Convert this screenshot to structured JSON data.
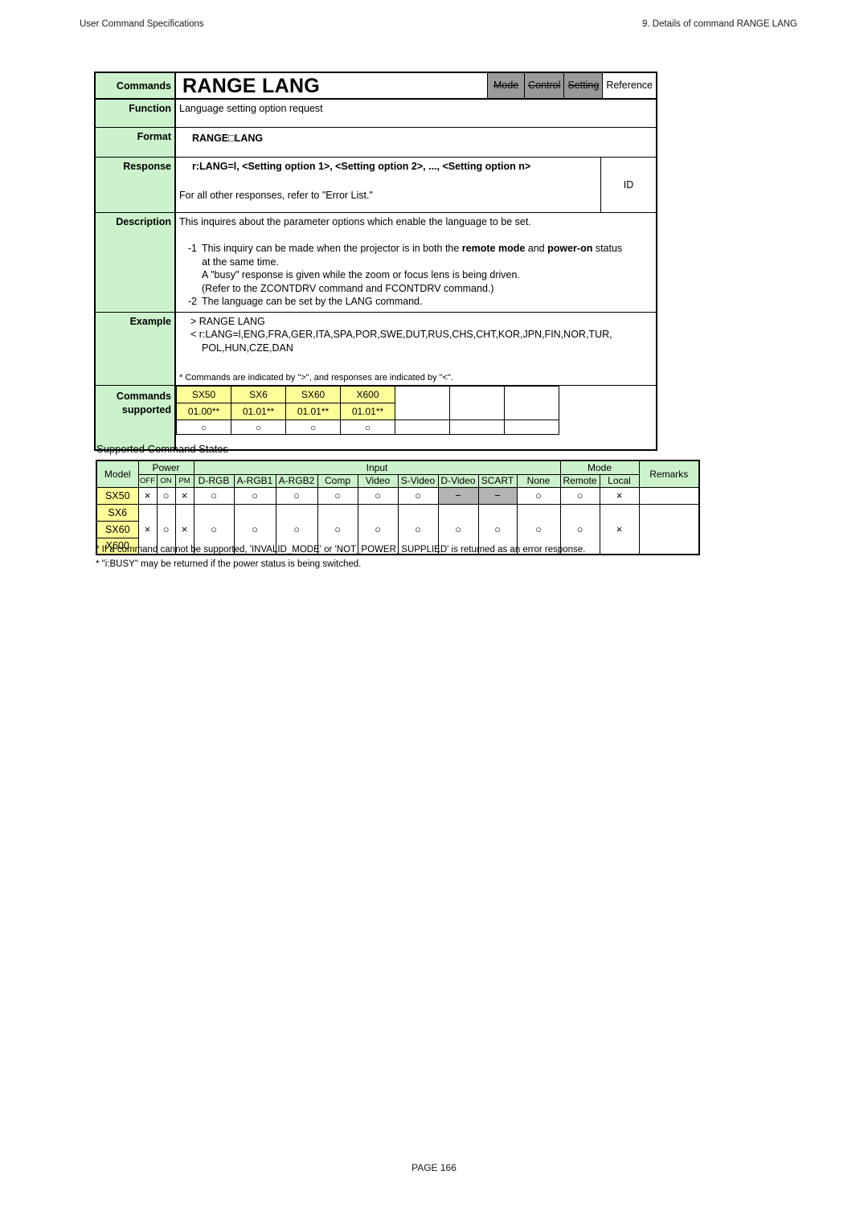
{
  "running_head": {
    "left": "User Command Specifications",
    "right": "9. Details of command  RANGE LANG"
  },
  "card": {
    "commands_label": "Commands",
    "command_name": "RANGE LANG",
    "tags": [
      {
        "label": "Mode",
        "active": false
      },
      {
        "label": "Control",
        "active": false
      },
      {
        "label": "Setting",
        "active": false
      },
      {
        "label": "Reference",
        "active": true
      }
    ],
    "function_label": "Function",
    "function_text": "Language setting option request",
    "format_label": "Format",
    "format_text": "RANGE□LANG",
    "response_label": "Response",
    "response_line1": "r:LANG=l, <Setting option 1>, <Setting option 2>, ..., <Setting option n>",
    "response_line2": "For all other responses, refer to \"Error List.\"",
    "response_id": "ID",
    "description_label": "Description",
    "description_intro": "This inquires about the parameter options which enable the language to be set.",
    "description_items": [
      {
        "num": "-1",
        "lines": [
          "This inquiry can be made when the projector is in both the remote mode and power-on status",
          "at the same time.",
          "A \"busy\" response is given while the zoom or focus lens is being driven.",
          "(Refer to the ZCONTDRV command and FCONTDRV command.)"
        ]
      },
      {
        "num": "-2",
        "lines": [
          "The language can be set by the LANG command."
        ]
      }
    ],
    "example_label": "Example",
    "example_lines": [
      "> RANGE LANG",
      "< r:LANG=l,ENG,FRA,GER,ITA,SPA,POR,SWE,DUT,RUS,CHS,CHT,KOR,JPN,FIN,NOR,TUR,"
    ],
    "example_continuation": "POL,HUN,CZE,DAN",
    "example_note": "* Commands are indicated by \">\", and responses are indicated by \"<\".",
    "supported_label_line1": "Commands",
    "supported_label_line2": "supported",
    "supported_models": [
      {
        "model": "SX50",
        "version": "01.00**",
        "mark": "○"
      },
      {
        "model": "SX6",
        "version": "01.01**",
        "mark": "○"
      },
      {
        "model": "SX60",
        "version": "01.01**",
        "mark": "○"
      },
      {
        "model": "X600",
        "version": "01.01**",
        "mark": "○"
      }
    ],
    "supported_empty_columns": 3
  },
  "states": {
    "title": "Supported Command States",
    "group_headers": {
      "model": "Model",
      "power": "Power",
      "input": "Input",
      "mode": "Mode",
      "remarks": "Remarks"
    },
    "power_columns": [
      "OFF",
      "ON",
      "PM"
    ],
    "input_columns": [
      "D-RGB",
      "A-RGB1",
      "A-RGB2",
      "Comp",
      "Video",
      "S-Video",
      "D-Video",
      "SCART",
      "None"
    ],
    "mode_columns": [
      "Remote",
      "Local"
    ],
    "rows": [
      {
        "models": [
          "SX50"
        ],
        "power": [
          "×",
          "○",
          "×"
        ],
        "input": [
          "○",
          "○",
          "○",
          "○",
          "○",
          "○",
          "−",
          "−",
          "○"
        ],
        "input_disabled": [
          false,
          false,
          false,
          false,
          false,
          false,
          true,
          true,
          false
        ],
        "mode": [
          "○",
          "×"
        ],
        "remarks": ""
      },
      {
        "models": [
          "SX6",
          "SX60",
          "X600"
        ],
        "power": [
          "×",
          "○",
          "×"
        ],
        "input": [
          "○",
          "○",
          "○",
          "○",
          "○",
          "○",
          "○",
          "○",
          "○"
        ],
        "input_disabled": [
          false,
          false,
          false,
          false,
          false,
          false,
          false,
          false,
          false
        ],
        "mode": [
          "○",
          "×"
        ],
        "remarks": ""
      }
    ]
  },
  "footnotes": [
    "* If a command cannot be supported, 'INVALID_MODE' or 'NOT_POWER_SUPPLIED' is returned as an error response.",
    "* \"i:BUSY\" may be returned if the power status is being switched."
  ],
  "page_footer": "PAGE 166",
  "colors": {
    "label_green": "#ccf2cc",
    "model_yellow": "#ffff99",
    "tag_disabled_gray": "#999999",
    "cell_disabled_gray": "#b3b3b3"
  }
}
